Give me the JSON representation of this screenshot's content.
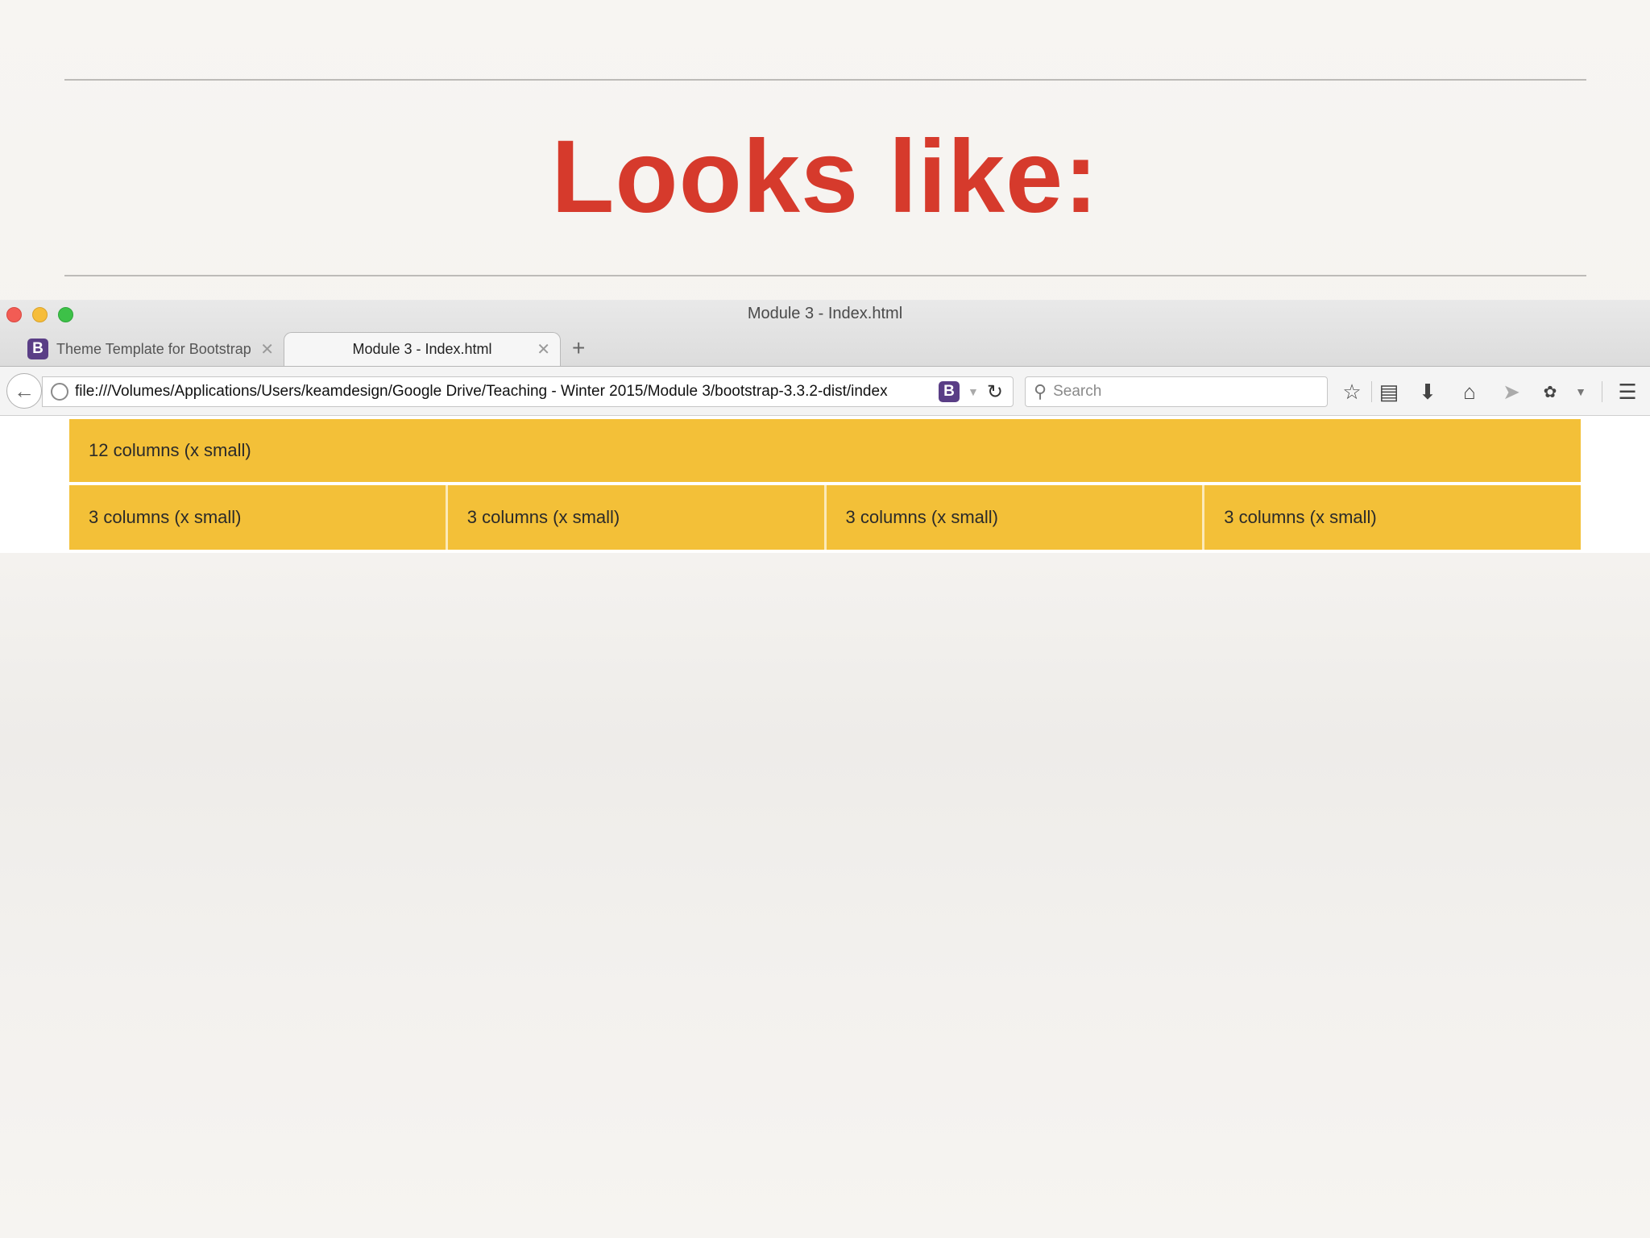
{
  "slide": {
    "title": "Looks like:"
  },
  "browser": {
    "window_title": "Module 3 - Index.html",
    "tabs": [
      {
        "label": "Theme Template for Bootstrap",
        "favicon": "B",
        "active": false
      },
      {
        "label": "Module 3 - Index.html",
        "active": true
      }
    ],
    "tab_close_glyph": "✕",
    "new_tab_glyph": "+",
    "url": "file:///Volumes/Applications/Users/keamdesign/Google Drive/Teaching - Winter 2015/Module 3/bootstrap-3.3.2-dist/index",
    "url_favicon": "B",
    "search_placeholder": "Search",
    "toolbar_icons": [
      "star-icon",
      "reading-list-icon",
      "download-icon",
      "home-icon",
      "send-icon",
      "extension-icon",
      "menu-icon"
    ]
  },
  "grid": {
    "row1": [
      "12 columns (x small)"
    ],
    "row2": [
      "3 columns (x small)",
      "3 columns (x small)",
      "3 columns (x small)",
      "3 columns (x small)"
    ]
  },
  "colors": {
    "title_red": "#d63a2c",
    "cell_yellow": "#f3c038",
    "favicon_purple": "#5a3e86"
  }
}
